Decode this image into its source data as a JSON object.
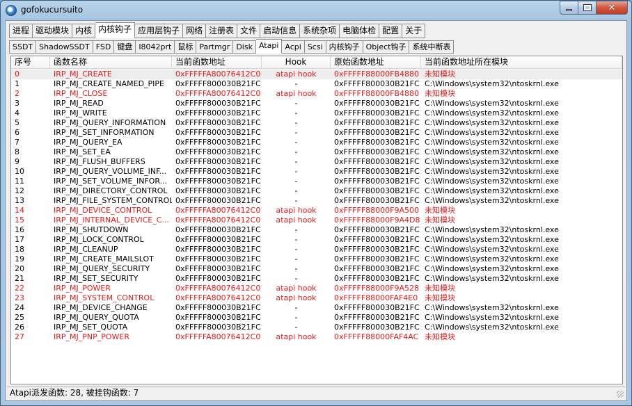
{
  "window": {
    "title": "gofokucursuito"
  },
  "caption": {
    "close_glyph": "✕"
  },
  "tabs_main": [
    "进程",
    "驱动模块",
    "内核",
    "内核钩子",
    "应用层钩子",
    "网络",
    "注册表",
    "文件",
    "启动信息",
    "系统杂项",
    "电脑体检",
    "配置",
    "关于"
  ],
  "tabs_main_active": 3,
  "tabs_sub": [
    "SSDT",
    "ShadowSSDT",
    "FSD",
    "键盘",
    "I8042prt",
    "鼠标",
    "Partmgr",
    "Disk",
    "Atapi",
    "Acpi",
    "Scsi",
    "内核钩子",
    "Object钩子",
    "系统中断表"
  ],
  "tabs_sub_active": 8,
  "columns": [
    "序号",
    "函数名称",
    "当前函数地址",
    "Hook",
    "原始函数地址",
    "当前函数地址所在模块"
  ],
  "rows": [
    [
      "0",
      "IRP_MJ_CREATE",
      "0xFFFFFA80076412C0",
      "atapi hook",
      "0xFFFFF88000FB4880",
      "未知模块"
    ],
    [
      "1",
      "IRP_MJ_CREATE_NAMED_PIPE",
      "0xFFFFF800030B21FC",
      "-",
      "0xFFFFF800030B21FC",
      "C:\\Windows\\system32\\ntoskrnl.exe"
    ],
    [
      "2",
      "IRP_MJ_CLOSE",
      "0xFFFFFA80076412C0",
      "atapi hook",
      "0xFFFFF88000FB4880",
      "未知模块"
    ],
    [
      "3",
      "IRP_MJ_READ",
      "0xFFFFF800030B21FC",
      "-",
      "0xFFFFF800030B21FC",
      "C:\\Windows\\system32\\ntoskrnl.exe"
    ],
    [
      "4",
      "IRP_MJ_WRITE",
      "0xFFFFF800030B21FC",
      "-",
      "0xFFFFF800030B21FC",
      "C:\\Windows\\system32\\ntoskrnl.exe"
    ],
    [
      "5",
      "IRP_MJ_QUERY_INFORMATION",
      "0xFFFFF800030B21FC",
      "-",
      "0xFFFFF800030B21FC",
      "C:\\Windows\\system32\\ntoskrnl.exe"
    ],
    [
      "6",
      "IRP_MJ_SET_INFORMATION",
      "0xFFFFF800030B21FC",
      "-",
      "0xFFFFF800030B21FC",
      "C:\\Windows\\system32\\ntoskrnl.exe"
    ],
    [
      "7",
      "IRP_MJ_QUERY_EA",
      "0xFFFFF800030B21FC",
      "-",
      "0xFFFFF800030B21FC",
      "C:\\Windows\\system32\\ntoskrnl.exe"
    ],
    [
      "8",
      "IRP_MJ_SET_EA",
      "0xFFFFF800030B21FC",
      "-",
      "0xFFFFF800030B21FC",
      "C:\\Windows\\system32\\ntoskrnl.exe"
    ],
    [
      "9",
      "IRP_MJ_FLUSH_BUFFERS",
      "0xFFFFF800030B21FC",
      "-",
      "0xFFFFF800030B21FC",
      "C:\\Windows\\system32\\ntoskrnl.exe"
    ],
    [
      "10",
      "IRP_MJ_QUERY_VOLUME_INF...",
      "0xFFFFF800030B21FC",
      "-",
      "0xFFFFF800030B21FC",
      "C:\\Windows\\system32\\ntoskrnl.exe"
    ],
    [
      "11",
      "IRP_MJ_SET_VOLUME_INFOR...",
      "0xFFFFF800030B21FC",
      "-",
      "0xFFFFF800030B21FC",
      "C:\\Windows\\system32\\ntoskrnl.exe"
    ],
    [
      "12",
      "IRP_MJ_DIRECTORY_CONTROL",
      "0xFFFFF800030B21FC",
      "-",
      "0xFFFFF800030B21FC",
      "C:\\Windows\\system32\\ntoskrnl.exe"
    ],
    [
      "13",
      "IRP_MJ_FILE_SYSTEM_CONTROL",
      "0xFFFFF800030B21FC",
      "-",
      "0xFFFFF800030B21FC",
      "C:\\Windows\\system32\\ntoskrnl.exe"
    ],
    [
      "14",
      "IRP_MJ_DEVICE_CONTROL",
      "0xFFFFFA80076412C0",
      "atapi hook",
      "0xFFFFF88000F9A500",
      "未知模块"
    ],
    [
      "15",
      "IRP_MJ_INTERNAL_DEVICE_C...",
      "0xFFFFFA80076412C0",
      "atapi hook",
      "0xFFFFF88000F9A4D8",
      "未知模块"
    ],
    [
      "16",
      "IRP_MJ_SHUTDOWN",
      "0xFFFFF800030B21FC",
      "-",
      "0xFFFFF800030B21FC",
      "C:\\Windows\\system32\\ntoskrnl.exe"
    ],
    [
      "17",
      "IRP_MJ_LOCK_CONTROL",
      "0xFFFFF800030B21FC",
      "-",
      "0xFFFFF800030B21FC",
      "C:\\Windows\\system32\\ntoskrnl.exe"
    ],
    [
      "18",
      "IRP_MJ_CLEANUP",
      "0xFFFFF800030B21FC",
      "-",
      "0xFFFFF800030B21FC",
      "C:\\Windows\\system32\\ntoskrnl.exe"
    ],
    [
      "19",
      "IRP_MJ_CREATE_MAILSLOT",
      "0xFFFFF800030B21FC",
      "-",
      "0xFFFFF800030B21FC",
      "C:\\Windows\\system32\\ntoskrnl.exe"
    ],
    [
      "20",
      "IRP_MJ_QUERY_SECURITY",
      "0xFFFFF800030B21FC",
      "-",
      "0xFFFFF800030B21FC",
      "C:\\Windows\\system32\\ntoskrnl.exe"
    ],
    [
      "21",
      "IRP_MJ_SET_SECURITY",
      "0xFFFFF800030B21FC",
      "-",
      "0xFFFFF800030B21FC",
      "C:\\Windows\\system32\\ntoskrnl.exe"
    ],
    [
      "22",
      "IRP_MJ_POWER",
      "0xFFFFFA80076412C0",
      "atapi hook",
      "0xFFFFF88000F9A528",
      "未知模块"
    ],
    [
      "23",
      "IRP_MJ_SYSTEM_CONTROL",
      "0xFFFFFA80076412C0",
      "atapi hook",
      "0xFFFFF88000FAF4E0",
      "未知模块"
    ],
    [
      "24",
      "IRP_MJ_DEVICE_CHANGE",
      "0xFFFFF800030B21FC",
      "-",
      "0xFFFFF800030B21FC",
      "C:\\Windows\\system32\\ntoskrnl.exe"
    ],
    [
      "25",
      "IRP_MJ_QUERY_QUOTA",
      "0xFFFFF800030B21FC",
      "-",
      "0xFFFFF800030B21FC",
      "C:\\Windows\\system32\\ntoskrnl.exe"
    ],
    [
      "26",
      "IRP_MJ_SET_QUOTA",
      "0xFFFFF800030B21FC",
      "-",
      "0xFFFFF800030B21FC",
      "C:\\Windows\\system32\\ntoskrnl.exe"
    ],
    [
      "27",
      "IRP_MJ_PNP_POWER",
      "0xFFFFFA80076412C0",
      "atapi hook",
      "0xFFFFF88000FAF4AC",
      "未知模块"
    ]
  ],
  "hooked_color": "#e41b1b",
  "status": {
    "text": "Atapi派发函数: 28, 被挂钩函数: 7"
  }
}
